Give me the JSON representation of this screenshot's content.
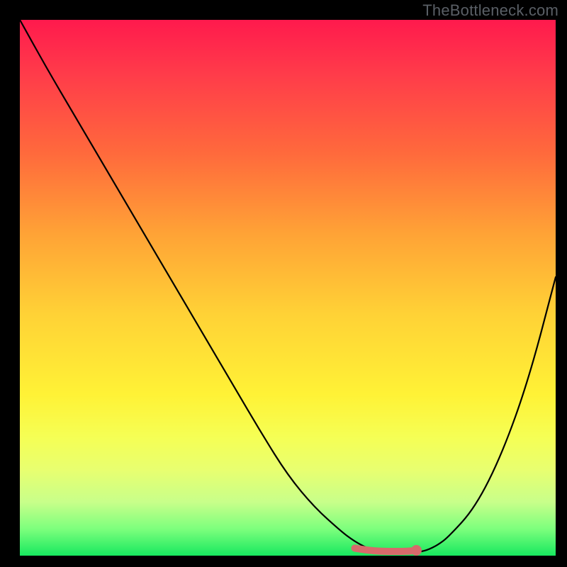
{
  "watermark": "TheBottleneck.com",
  "chart_data": {
    "type": "line",
    "title": "",
    "xlabel": "",
    "ylabel": "",
    "xlim": [
      0,
      100
    ],
    "ylim": [
      0,
      100
    ],
    "grid": false,
    "legend": false,
    "x": [
      0,
      5,
      10,
      15,
      20,
      25,
      30,
      35,
      40,
      45,
      50,
      55,
      60,
      62,
      64,
      66,
      68,
      70,
      72,
      74,
      76,
      78,
      80,
      85,
      90,
      95,
      100
    ],
    "values": [
      100,
      91,
      82.5,
      74,
      65.5,
      57,
      48.5,
      40,
      31.5,
      23,
      15,
      9,
      4.5,
      3,
      1.8,
      1,
      0.5,
      0.5,
      0.5,
      0.6,
      1,
      2,
      3.5,
      9,
      19,
      33,
      52
    ],
    "highlight": {
      "x": [
        62.5,
        65,
        67.5,
        70,
        72.5,
        74
      ],
      "values": [
        1.4,
        1.0,
        0.8,
        0.8,
        0.8,
        1.0
      ],
      "color": "#d76a6b"
    },
    "curve_color": "#000000",
    "background_gradient": [
      {
        "stop": 0.0,
        "color": "#ff1a4d"
      },
      {
        "stop": 0.55,
        "color": "#ffd236"
      },
      {
        "stop": 1.0,
        "color": "#17e85f"
      }
    ]
  }
}
